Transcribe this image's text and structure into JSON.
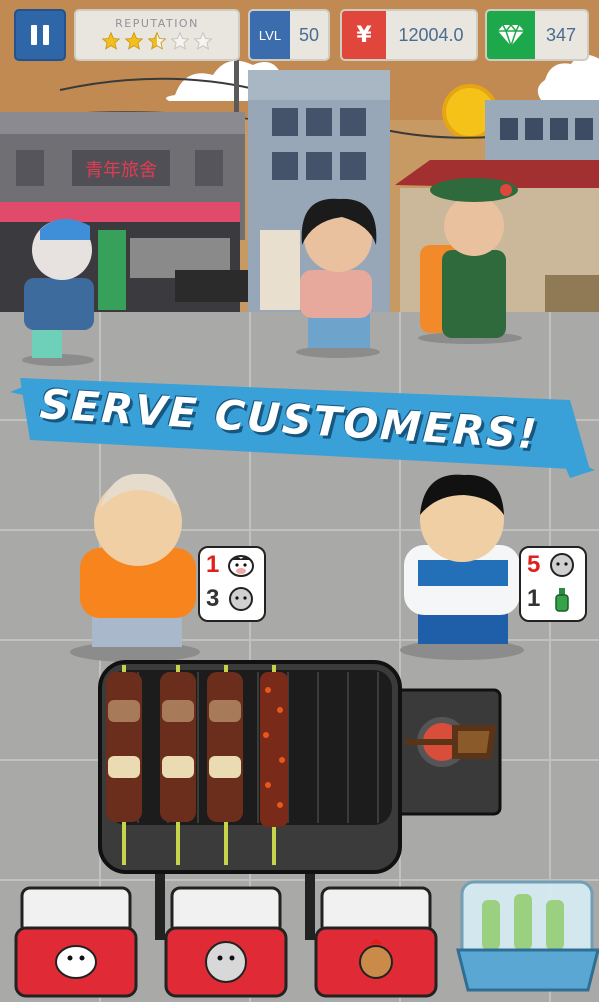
{
  "hud": {
    "reputation_label": "REPUTATION",
    "reputation_stars_filled": 3,
    "reputation_stars_total": 5,
    "level_tag": "LVL",
    "level_value": "50",
    "money_symbol": "¥",
    "money_value": "12004.0",
    "gems_value": "347"
  },
  "banner": {
    "text": "SERVE CUSTOMERS!"
  },
  "scenery": {
    "hostel_sign": "青年旅舍"
  },
  "orders": [
    {
      "customer": "old-man",
      "items": [
        {
          "qty": "1",
          "icon": "cow-icon",
          "highlight": true
        },
        {
          "qty": "3",
          "icon": "sheep-icon",
          "highlight": false
        }
      ]
    },
    {
      "customer": "young-man",
      "items": [
        {
          "qty": "5",
          "icon": "sheep-icon",
          "highlight": true
        },
        {
          "qty": "1",
          "icon": "beer-bottle-icon",
          "highlight": false
        }
      ]
    }
  ],
  "grill": {
    "skewers": [
      "beef-skewer",
      "beef-skewer",
      "beef-skewer",
      "spicy-skewer"
    ]
  },
  "coolers": [
    {
      "name": "beef",
      "icon": "cow-icon"
    },
    {
      "name": "lamb",
      "icon": "sheep-icon"
    },
    {
      "name": "chicken",
      "icon": "chicken-icon"
    },
    {
      "name": "drinks",
      "icon": "beer-bucket-icon"
    }
  ],
  "colors": {
    "accent_blue": "#2f66a8",
    "money_red": "#e0463b",
    "gem_green": "#1ea84c",
    "banner_blue": "#3aa0d8",
    "order_red": "#e0201c"
  }
}
